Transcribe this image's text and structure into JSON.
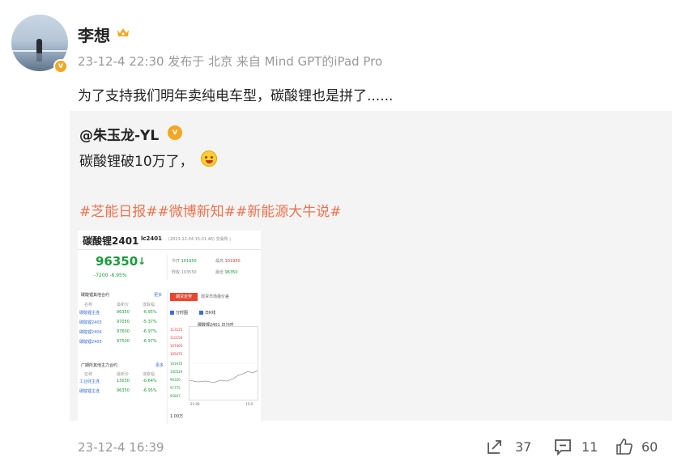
{
  "post": {
    "author": "李想",
    "meta": "23-12-4 22:30 发布于 北京 来自 Mind GPT的iPad Pro",
    "text": "为了支持我们明年卖纯电车型，碳酸锂也是拼了......",
    "verified_mark": "v"
  },
  "repost": {
    "user": "@朱玉龙-YL",
    "verified_mark": "v",
    "text": "碳酸锂破10万了，",
    "emoji": "grin-emoji",
    "tags": "#芝能日报##微博新知##新能源大牛说#",
    "image": {
      "title": "碳酸锂2401",
      "code": "lc2401",
      "date": "(2023-12-04 15:01:46)",
      "status": "交易所 |",
      "price": "96350",
      "arrow": "↓",
      "change": "-7200   -6.95%",
      "stats": [
        {
          "k": "今开",
          "v": "101950",
          "c": "grn"
        },
        {
          "k": "最高",
          "v": "101950",
          "c": "red"
        },
        {
          "k": "昨收",
          "v": "103550",
          "c": ""
        },
        {
          "k": "最低",
          "v": "96350",
          "c": "grn"
        }
      ],
      "section1": "碳酸锂其他合约",
      "section1_more": "更多",
      "headers": [
        "名称",
        "最新价",
        "涨跌幅"
      ],
      "rows1": [
        {
          "name": "碳酸锂主连",
          "price": "96350",
          "pct": "-6.95%"
        },
        {
          "name": "碳酸锂2403",
          "price": "97050",
          "pct": "-5.37%"
        },
        {
          "name": "碳酸锂2404",
          "price": "97600",
          "pct": "-6.97%"
        },
        {
          "name": "碳酸锂2405",
          "price": "97500",
          "pct": "-6.97%"
        }
      ],
      "section2": "广期所其他主力合约",
      "section2_more": "更多",
      "rows2": [
        {
          "name": "工业硅主连",
          "price": "13030",
          "pct": "-0.64%"
        },
        {
          "name": "碳酸锂主连",
          "price": "96350",
          "pct": "-6.95%"
        }
      ],
      "tab_active": "期货走势",
      "tab_other": "现货市场报价差",
      "options": [
        "分时图",
        "日K线"
      ],
      "chart_title": "碳酸锂2401 日分时",
      "y_labels_red": [
        "113125",
        "110150",
        "107405",
        "105475"
      ],
      "y_labels_green": [
        "101935",
        "100520",
        "99330",
        "97775",
        "95847"
      ],
      "x_labels": [
        "21:00",
        "15:0"
      ],
      "volume": "1.00万"
    }
  },
  "footer": {
    "time": "23-12-4 16:39",
    "reposts": "37",
    "comments": "11",
    "likes": "60"
  }
}
